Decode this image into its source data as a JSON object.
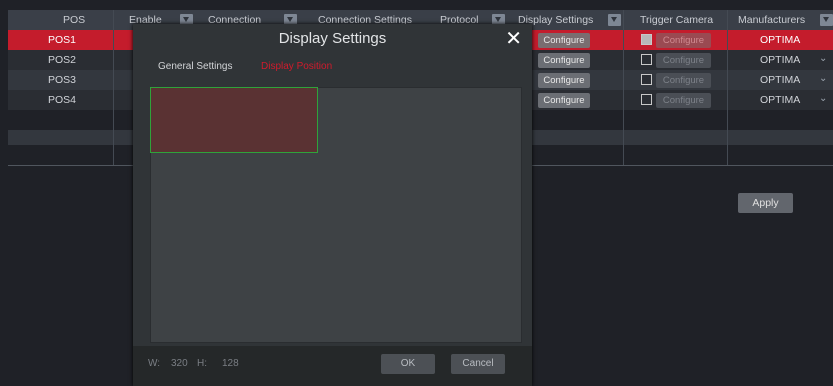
{
  "table": {
    "headers": {
      "pos": "POS",
      "enable": "Enable",
      "connection": "Connection",
      "connection_settings": "Connection Settings",
      "protocol": "Protocol",
      "display_settings": "Display Settings",
      "trigger_camera": "Trigger Camera",
      "manufacturers": "Manufacturers"
    },
    "rows": [
      {
        "pos": "POS1",
        "configure": "Configure",
        "trigger_configure": "Configure",
        "manufacturer": "OPTIMA",
        "selected": true
      },
      {
        "pos": "POS2",
        "configure": "Configure",
        "trigger_configure": "Configure",
        "manufacturer": "OPTIMA",
        "selected": false
      },
      {
        "pos": "POS3",
        "configure": "Configure",
        "trigger_configure": "Configure",
        "manufacturer": "OPTIMA",
        "selected": false
      },
      {
        "pos": "POS4",
        "configure": "Configure",
        "trigger_configure": "Configure",
        "manufacturer": "OPTIMA",
        "selected": false
      }
    ]
  },
  "apply_label": "Apply",
  "modal": {
    "title": "Display Settings",
    "close_icon": "close-icon",
    "tabs": [
      "General Settings",
      "Display Position"
    ],
    "width_label": "W:",
    "width_value": "320",
    "height_label": "H:",
    "height_value": "128",
    "ok_label": "OK",
    "cancel_label": "Cancel"
  },
  "colors": {
    "selected_row": "#c41c2c",
    "accent_tab": "#d01b2c",
    "overlay_border": "#2fa33a",
    "overlay_fill": "#5a3233"
  }
}
